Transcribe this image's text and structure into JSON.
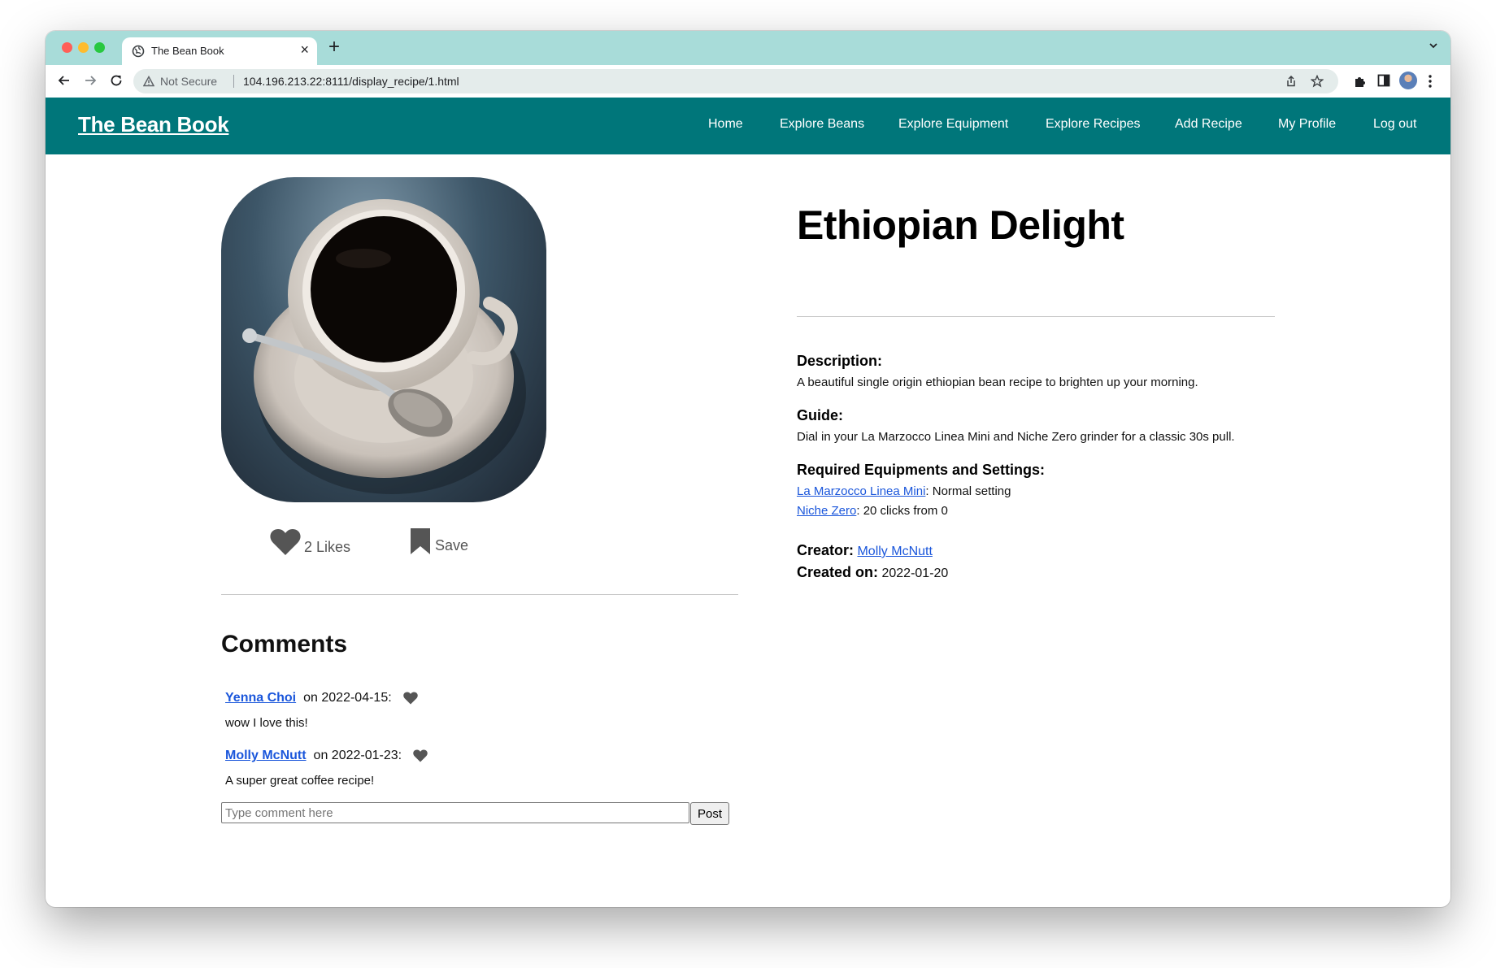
{
  "browser": {
    "tab_title": "The Bean Book",
    "security_label": "Not Secure",
    "url": "104.196.213.22:8111/display_recipe/1.html"
  },
  "site": {
    "brand": "The Bean Book",
    "nav": [
      "Home",
      "Explore Beans",
      "Explore Equipment",
      "Explore Recipes",
      "Add Recipe",
      "My Profile",
      "Log out"
    ]
  },
  "recipe": {
    "title": "Ethiopian Delight",
    "likes_label": "2 Likes",
    "save_label": "Save",
    "description_label": "Description:",
    "description": "A beautiful single origin ethiopian bean recipe to brighten up your morning.",
    "guide_label": "Guide:",
    "guide": "Dial in your La Marzocco Linea Mini and Niche Zero grinder for a classic 30s pull.",
    "equipment_label": "Required Equipments and Settings:",
    "equipment": [
      {
        "name": "La Marzocco Linea Mini",
        "setting": ": Normal setting"
      },
      {
        "name": "Niche Zero",
        "setting": ": 20 clicks from 0"
      }
    ],
    "creator_label": "Creator:",
    "creator": "Molly McNutt",
    "created_label": "Created on:",
    "created_on": "2022-01-20"
  },
  "comments": {
    "heading": "Comments",
    "items": [
      {
        "author": "Yenna Choi",
        "date": "on 2022-04-15:",
        "text": "wow I love this!"
      },
      {
        "author": "Molly McNutt",
        "date": "on 2022-01-23:",
        "text": "A super great coffee recipe!"
      }
    ],
    "input_placeholder": "Type comment here",
    "post_label": "Post"
  },
  "colors": {
    "header_bg": "#00767a",
    "tabstrip_bg": "#a8dcd9",
    "link": "#1a56db"
  }
}
